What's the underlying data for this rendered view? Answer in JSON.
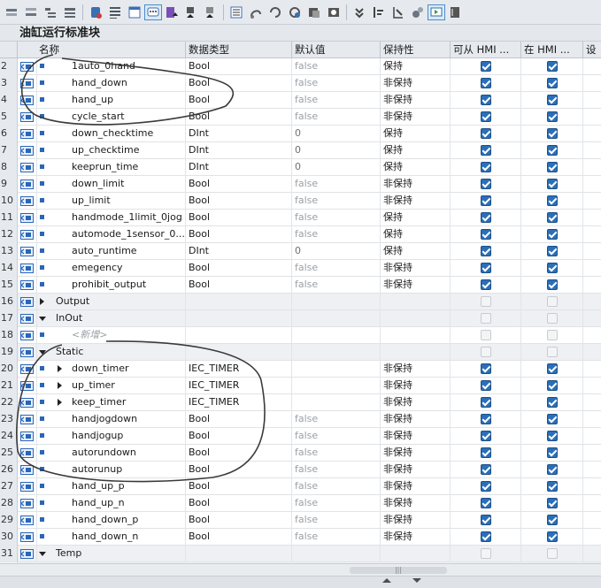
{
  "toolbar": {
    "buttons": [
      "insert-row-icon",
      "insert-row-below-icon",
      "expand-icon",
      "collapse-icon",
      "plc-icon",
      "list-icon",
      "table-icon",
      "monitor-icon",
      "comment-icon",
      "download-icon",
      "download-alt-icon",
      "list-selected-icon",
      "snapshot-icon",
      "reset-start-icon",
      "reset-icon",
      "copy-snapshot-icon",
      "load-snapshot-icon",
      "compare-icon",
      "set-value-icon",
      "tree-icon",
      "tags-icon",
      "monitor-all-icon",
      "close-view-icon"
    ]
  },
  "block_title": "油缸运行标准块",
  "columns": {
    "name": "名称",
    "data_type": "数据类型",
    "default_value": "默认值",
    "retain": "保持性",
    "hmi_access": "可从 HMI ...",
    "hmi_visible": "在 HMI ...",
    "setpoint": "设"
  },
  "rows": [
    {
      "num": "2",
      "name": "1auto_0hand",
      "type": "Bool",
      "default": "false",
      "retain": "保持",
      "hmi1": true,
      "hmi2": true,
      "kind": "var"
    },
    {
      "num": "3",
      "name": "hand_down",
      "type": "Bool",
      "default": "false",
      "retain": "非保持",
      "hmi1": true,
      "hmi2": true,
      "kind": "var"
    },
    {
      "num": "4",
      "name": "hand_up",
      "type": "Bool",
      "default": "false",
      "retain": "非保持",
      "hmi1": true,
      "hmi2": true,
      "kind": "var"
    },
    {
      "num": "5",
      "name": "cycle_start",
      "type": "Bool",
      "default": "false",
      "retain": "非保持",
      "hmi1": true,
      "hmi2": true,
      "kind": "var"
    },
    {
      "num": "6",
      "name": "down_checktime",
      "type": "DInt",
      "default": "0",
      "retain": "保持",
      "hmi1": true,
      "hmi2": true,
      "kind": "var"
    },
    {
      "num": "7",
      "name": "up_checktime",
      "type": "DInt",
      "default": "0",
      "retain": "保持",
      "hmi1": true,
      "hmi2": true,
      "kind": "var"
    },
    {
      "num": "8",
      "name": "keeprun_time",
      "type": "DInt",
      "default": "0",
      "retain": "保持",
      "hmi1": true,
      "hmi2": true,
      "kind": "var"
    },
    {
      "num": "9",
      "name": "down_limit",
      "type": "Bool",
      "default": "false",
      "retain": "非保持",
      "hmi1": true,
      "hmi2": true,
      "kind": "var"
    },
    {
      "num": "10",
      "name": "up_limit",
      "type": "Bool",
      "default": "false",
      "retain": "非保持",
      "hmi1": true,
      "hmi2": true,
      "kind": "var"
    },
    {
      "num": "11",
      "name": "handmode_1limit_0jog",
      "type": "Bool",
      "default": "false",
      "retain": "保持",
      "hmi1": true,
      "hmi2": true,
      "kind": "var"
    },
    {
      "num": "12",
      "name": "automode_1sensor_0...",
      "type": "Bool",
      "default": "false",
      "retain": "保持",
      "hmi1": true,
      "hmi2": true,
      "kind": "var"
    },
    {
      "num": "13",
      "name": "auto_runtime",
      "type": "DInt",
      "default": "0",
      "retain": "保持",
      "hmi1": true,
      "hmi2": true,
      "kind": "var"
    },
    {
      "num": "14",
      "name": "emegency",
      "type": "Bool",
      "default": "false",
      "retain": "非保持",
      "hmi1": true,
      "hmi2": true,
      "kind": "var"
    },
    {
      "num": "15",
      "name": "prohibit_output",
      "type": "Bool",
      "default": "false",
      "retain": "非保持",
      "hmi1": true,
      "hmi2": true,
      "kind": "var"
    },
    {
      "num": "16",
      "name": "Output",
      "type": "",
      "default": "",
      "retain": "",
      "hmi1": false,
      "hmi2": false,
      "kind": "section-collapsed"
    },
    {
      "num": "17",
      "name": "InOut",
      "type": "",
      "default": "",
      "retain": "",
      "hmi1": false,
      "hmi2": false,
      "kind": "section"
    },
    {
      "num": "18",
      "name": "<新增>",
      "type": "",
      "default": "",
      "retain": "",
      "hmi1": false,
      "hmi2": false,
      "kind": "add"
    },
    {
      "num": "19",
      "name": "Static",
      "type": "",
      "default": "",
      "retain": "",
      "hmi1": false,
      "hmi2": false,
      "kind": "section"
    },
    {
      "num": "20",
      "name": "down_timer",
      "type": "IEC_TIMER",
      "default": "",
      "retain": "非保持",
      "hmi1": true,
      "hmi2": true,
      "kind": "struct"
    },
    {
      "num": "21",
      "name": "up_timer",
      "type": "IEC_TIMER",
      "default": "",
      "retain": "非保持",
      "hmi1": true,
      "hmi2": true,
      "kind": "struct"
    },
    {
      "num": "22",
      "name": "keep_timer",
      "type": "IEC_TIMER",
      "default": "",
      "retain": "非保持",
      "hmi1": true,
      "hmi2": true,
      "kind": "struct"
    },
    {
      "num": "23",
      "name": "handjogdown",
      "type": "Bool",
      "default": "false",
      "retain": "非保持",
      "hmi1": true,
      "hmi2": true,
      "kind": "var"
    },
    {
      "num": "24",
      "name": "handjogup",
      "type": "Bool",
      "default": "false",
      "retain": "非保持",
      "hmi1": true,
      "hmi2": true,
      "kind": "var"
    },
    {
      "num": "25",
      "name": "autorundown",
      "type": "Bool",
      "default": "false",
      "retain": "非保持",
      "hmi1": true,
      "hmi2": true,
      "kind": "var"
    },
    {
      "num": "26",
      "name": "autorunup",
      "type": "Bool",
      "default": "false",
      "retain": "非保持",
      "hmi1": true,
      "hmi2": true,
      "kind": "var"
    },
    {
      "num": "27",
      "name": "hand_up_p",
      "type": "Bool",
      "default": "false",
      "retain": "非保持",
      "hmi1": true,
      "hmi2": true,
      "kind": "var"
    },
    {
      "num": "28",
      "name": "hand_up_n",
      "type": "Bool",
      "default": "false",
      "retain": "非保持",
      "hmi1": true,
      "hmi2": true,
      "kind": "var"
    },
    {
      "num": "29",
      "name": "hand_down_p",
      "type": "Bool",
      "default": "false",
      "retain": "非保持",
      "hmi1": true,
      "hmi2": true,
      "kind": "var"
    },
    {
      "num": "30",
      "name": "hand_down_n",
      "type": "Bool",
      "default": "false",
      "retain": "非保持",
      "hmi1": true,
      "hmi2": true,
      "kind": "var"
    },
    {
      "num": "31",
      "name": "Temp",
      "type": "",
      "default": "",
      "retain": "",
      "hmi1": false,
      "hmi2": false,
      "kind": "section"
    }
  ],
  "scrollbar": {
    "thumb_label": "|||"
  },
  "colors": {
    "accent": "#2b6fb8",
    "annotation": "#3a3a3a",
    "default_grey": "#9aa0a6"
  }
}
